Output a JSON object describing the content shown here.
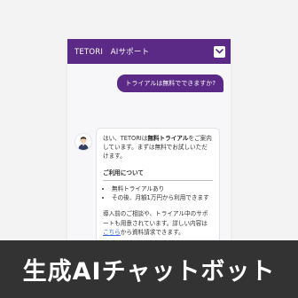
{
  "widget": {
    "header_title": "TETORI　AIサポート",
    "collapse_icon": "chevron-down-icon"
  },
  "messages": {
    "user_message": "トライアルは無料でできますか?",
    "bot": {
      "avatar_icon": "person-icon",
      "intro_prefix": "はい、TETORIは",
      "intro_bold": "無料トライアル",
      "intro_suffix": "をご案内しています。まずは無料でお試しいただけます。",
      "section_title": "ご利用について",
      "list": [
        "無料トライアルあり",
        "その後、月額1万円から利用できます"
      ],
      "closing_prefix": "導入前のご相談や、トライアル中のサポートも用意されています。詳しい内容は",
      "closing_link": "こちら",
      "closing_suffix": "から資料請求できます。"
    }
  },
  "banner": {
    "text": "生成AIチャットボット"
  },
  "colors": {
    "brand": "#5b2a86",
    "link": "#3a66d6",
    "banner": "#333333"
  }
}
